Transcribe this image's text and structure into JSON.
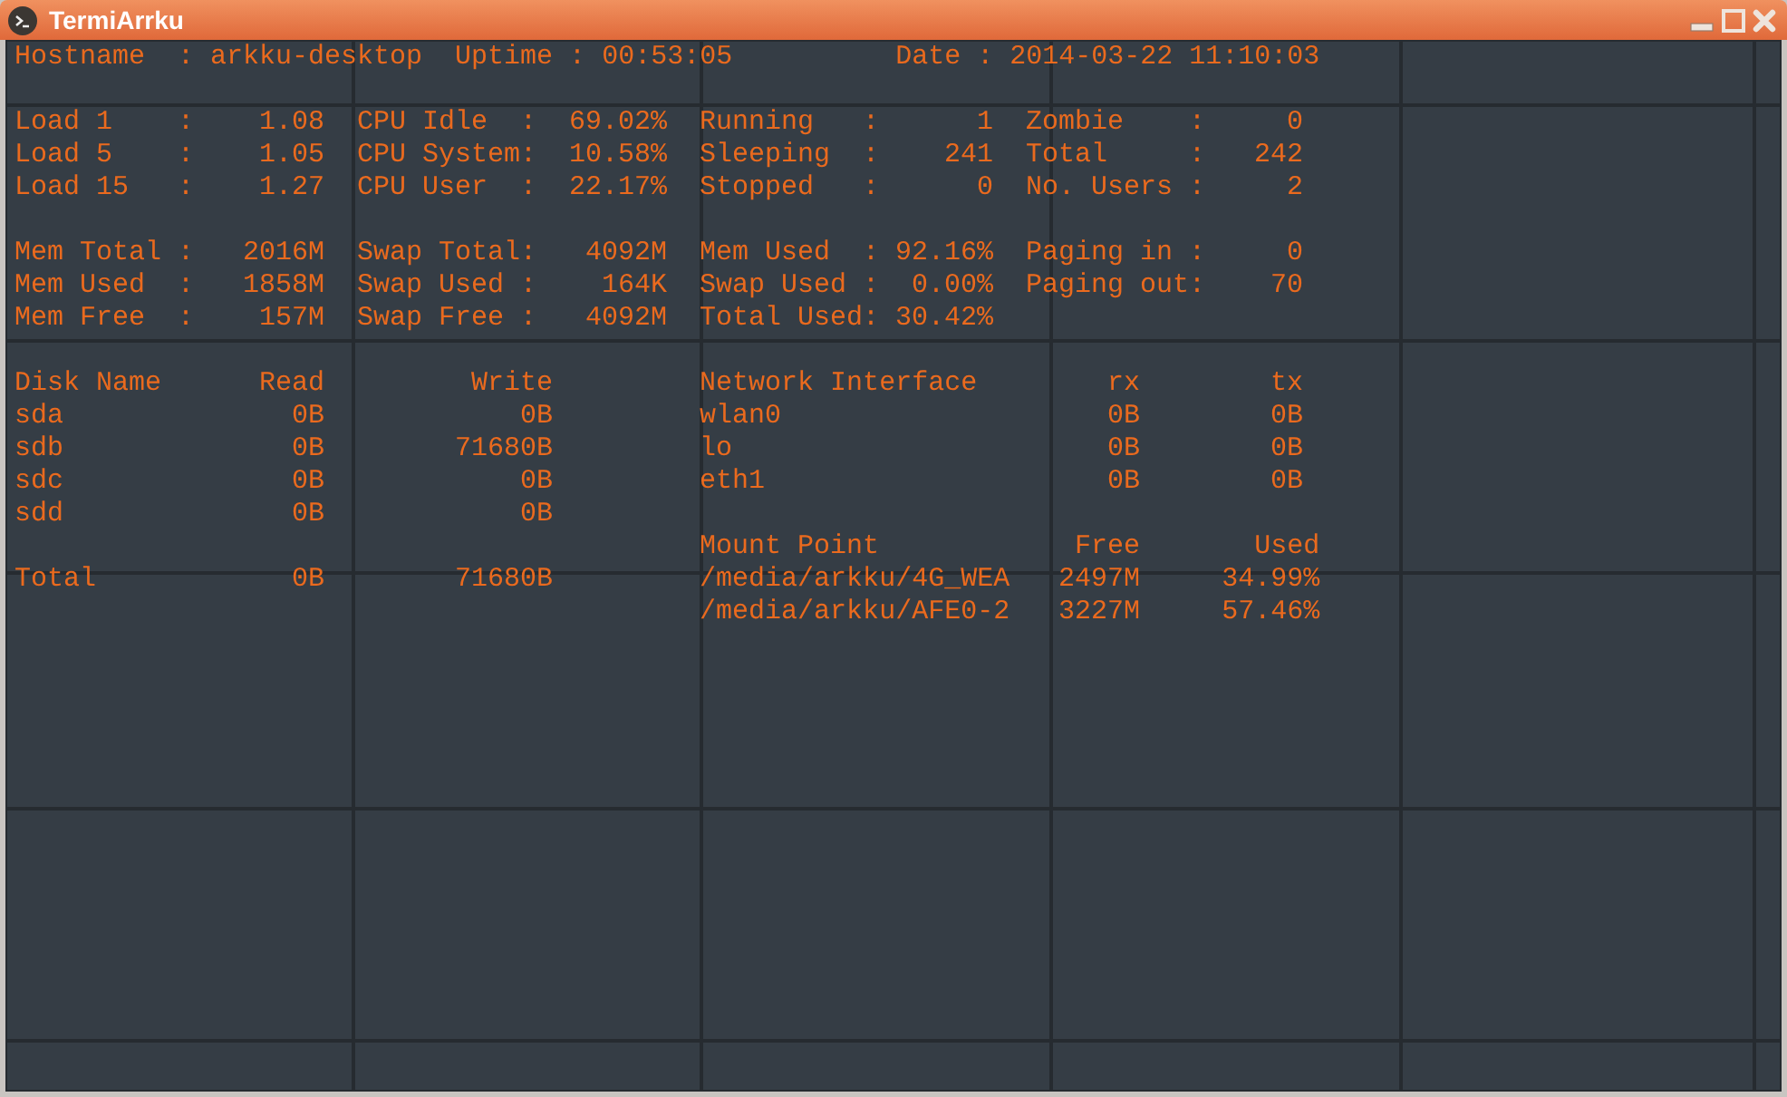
{
  "window": {
    "title": "TermiArrku"
  },
  "header": [
    {
      "label": "Hostname",
      "sep": ":",
      "value": "arkku-desktop"
    },
    {
      "label": "Uptime",
      "sep": ":",
      "value": "00:53:05"
    },
    {
      "label": "Date",
      "sep": ":",
      "value": "2014-03-22 11:10:03"
    }
  ],
  "stat_blocks": [
    [
      [
        {
          "label": "Load 1",
          "sep": ":",
          "value": "1.08"
        },
        {
          "label": "Load 5",
          "sep": ":",
          "value": "1.05"
        },
        {
          "label": "Load 15",
          "sep": ":",
          "value": "1.27"
        }
      ],
      [
        {
          "label": "CPU Idle",
          "sep": ":",
          "value": "69.02%"
        },
        {
          "label": "CPU System",
          "sep": ":",
          "value": "10.58%"
        },
        {
          "label": "CPU User",
          "sep": ":",
          "value": "22.17%"
        }
      ],
      [
        {
          "label": "Running",
          "sep": ":",
          "value": "1"
        },
        {
          "label": "Sleeping",
          "sep": ":",
          "value": "241"
        },
        {
          "label": "Stopped",
          "sep": ":",
          "value": "0"
        }
      ],
      [
        {
          "label": "Zombie",
          "sep": ":",
          "value": "0"
        },
        {
          "label": "Total",
          "sep": ":",
          "value": "242"
        },
        {
          "label": "No. Users",
          "sep": ":",
          "value": "2"
        }
      ]
    ],
    [
      [
        {
          "label": "Mem Total",
          "sep": ":",
          "value": "2016M"
        },
        {
          "label": "Mem Used",
          "sep": ":",
          "value": "1858M"
        },
        {
          "label": "Mem Free",
          "sep": ":",
          "value": "157M"
        }
      ],
      [
        {
          "label": "Swap Total",
          "sep": ":",
          "value": "4092M"
        },
        {
          "label": "Swap Used",
          "sep": ":",
          "value": "164K"
        },
        {
          "label": "Swap Free",
          "sep": ":",
          "value": "4092M"
        }
      ],
      [
        {
          "label": "Mem Used",
          "sep": ":",
          "value": "92.16%"
        },
        {
          "label": "Swap Used",
          "sep": ":",
          "value": "0.00%"
        },
        {
          "label": "Total Used",
          "sep": ":",
          "value": "30.42%"
        }
      ],
      [
        {
          "label": "Paging in",
          "sep": ":",
          "value": "0"
        },
        {
          "label": "Paging out",
          "sep": ":",
          "value": "70"
        }
      ]
    ]
  ],
  "disks": {
    "columns": [
      "Disk Name",
      "Read",
      "Write"
    ],
    "rows": [
      [
        "sda",
        "0B",
        "0B"
      ],
      [
        "sdb",
        "0B",
        "71680B"
      ],
      [
        "sdc",
        "0B",
        "0B"
      ],
      [
        "sdd",
        "0B",
        "0B"
      ]
    ],
    "total": [
      "Total",
      "0B",
      "71680B"
    ]
  },
  "network": {
    "columns": [
      "Network Interface",
      "rx",
      "tx"
    ],
    "rows": [
      [
        "wlan0",
        "0B",
        "0B"
      ],
      [
        "lo",
        "0B",
        "0B"
      ],
      [
        "eth1",
        "0B",
        "0B"
      ]
    ]
  },
  "mounts": {
    "columns": [
      "Mount Point",
      "Free",
      "Used"
    ],
    "rows": [
      [
        "/media/arkku/4G_WEA",
        "2497M",
        "34.99%"
      ],
      [
        "/media/arkku/AFE0-2",
        "3227M",
        "57.46%"
      ]
    ]
  }
}
